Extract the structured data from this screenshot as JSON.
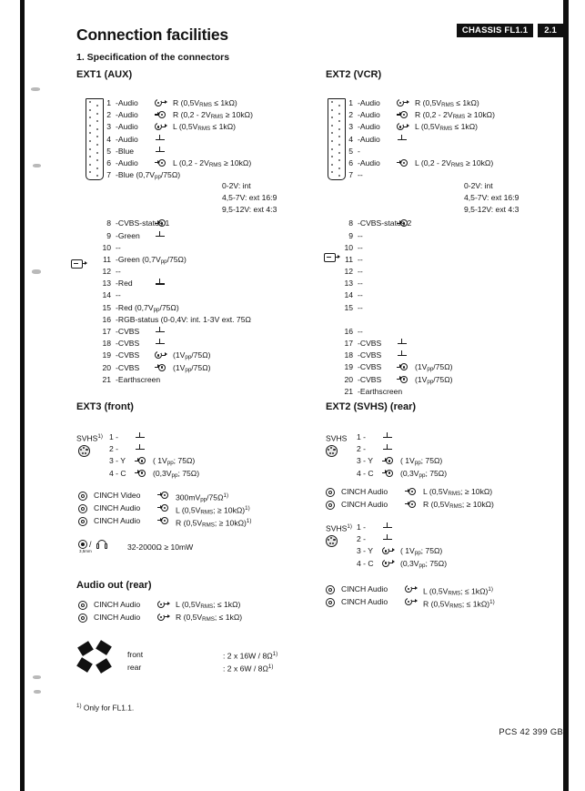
{
  "header": {
    "title": "Connection facilities",
    "subtitle": "1. Specification of the connectors",
    "chassis_badge": "CHASSIS FL1.1",
    "page_badge": "2.1"
  },
  "sections": {
    "ext1": {
      "heading": "EXT1 (AUX)",
      "pins": [
        {
          "no": "1",
          "name": "-Audio",
          "arrow": "out",
          "value": "R (0,5VRMS ≤ 1kΩ)"
        },
        {
          "no": "2",
          "name": "-Audio",
          "arrow": "in",
          "value": "R (0,2 - 2VRMS ≥ 10kΩ)"
        },
        {
          "no": "3",
          "name": "-Audio",
          "arrow": "out",
          "value": "L (0,5VRMS ≤ 1kΩ)"
        },
        {
          "no": "4",
          "name": "-Audio",
          "arrow": "gnd",
          "value": ""
        },
        {
          "no": "5",
          "name": "-Blue",
          "arrow": "gnd",
          "value": ""
        },
        {
          "no": "6",
          "name": "-Audio",
          "arrow": "in",
          "value": "L (0,2 - 2VRMS ≥ 10kΩ)"
        },
        {
          "no": "7",
          "name": "-Blue (0,7Vpp/75Ω)",
          "arrow": "none",
          "value": ""
        },
        {
          "no": "8",
          "name": "-CVBS-status 1",
          "arrow": "in",
          "value": ""
        },
        {
          "no": "9",
          "name": "-Green",
          "arrow": "gnd",
          "value": ""
        },
        {
          "no": "10",
          "name": "--",
          "arrow": "none",
          "value": ""
        },
        {
          "no": "11",
          "name": "-Green (0,7Vpp/75Ω)",
          "arrow": "none",
          "value": ""
        },
        {
          "no": "12",
          "name": "--",
          "arrow": "none",
          "value": ""
        },
        {
          "no": "13",
          "name": "-Red",
          "arrow": "gnd",
          "value": ""
        },
        {
          "no": "14",
          "name": "--",
          "arrow": "none",
          "value": ""
        },
        {
          "no": "15",
          "name": "-Red (0,7Vpp/75Ω)",
          "arrow": "none",
          "value": ""
        },
        {
          "no": "16",
          "name": "-RGB-status (0-0,4V: int. 1-3V ext. 75Ω",
          "arrow": "none",
          "value": ""
        },
        {
          "no": "17",
          "name": "-CVBS",
          "arrow": "gnd",
          "value": ""
        },
        {
          "no": "18",
          "name": "-CVBS",
          "arrow": "gnd",
          "value": ""
        },
        {
          "no": "19",
          "name": "-CVBS",
          "arrow": "out",
          "value": "(1Vpp/75Ω)"
        },
        {
          "no": "20",
          "name": "-CVBS",
          "arrow": "in",
          "value": "(1Vpp/75Ω)"
        },
        {
          "no": "21",
          "name": "-Earthscreen",
          "arrow": "none",
          "value": ""
        }
      ],
      "status": [
        "0-2V: int",
        "4,5-7V: ext 16:9",
        "9,5-12V: ext 4:3"
      ]
    },
    "ext2vcr": {
      "heading": "EXT2 (VCR)",
      "pins": [
        {
          "no": "1",
          "name": "-Audio",
          "arrow": "out",
          "value": "R (0,5VRMS ≤ 1kΩ)"
        },
        {
          "no": "2",
          "name": "-Audio",
          "arrow": "in",
          "value": "R (0,2 - 2VRMS ≥ 10kΩ)"
        },
        {
          "no": "3",
          "name": "-Audio",
          "arrow": "out",
          "value": "L (0,5VRMS ≤ 1kΩ)"
        },
        {
          "no": "4",
          "name": "-Audio",
          "arrow": "gnd",
          "value": ""
        },
        {
          "no": "5",
          "name": "-",
          "arrow": "none",
          "value": ""
        },
        {
          "no": "6",
          "name": "-Audio",
          "arrow": "in",
          "value": "L (0,2 - 2VRMS ≥ 10kΩ)"
        },
        {
          "no": "7",
          "name": "--",
          "arrow": "none",
          "value": ""
        },
        {
          "no": "8",
          "name": "-CVBS-status 2",
          "arrow": "in",
          "value": ""
        },
        {
          "no": "9",
          "name": "--",
          "arrow": "none",
          "value": ""
        },
        {
          "no": "10",
          "name": "--",
          "arrow": "none",
          "value": ""
        },
        {
          "no": "11",
          "name": "--",
          "arrow": "none",
          "value": ""
        },
        {
          "no": "12",
          "name": "--",
          "arrow": "none",
          "value": ""
        },
        {
          "no": "13",
          "name": "--",
          "arrow": "none",
          "value": ""
        },
        {
          "no": "14",
          "name": "--",
          "arrow": "none",
          "value": ""
        },
        {
          "no": "15",
          "name": "--",
          "arrow": "none",
          "value": ""
        },
        {
          "no": "16",
          "name": "--",
          "arrow": "none",
          "value": ""
        },
        {
          "no": "17",
          "name": "-CVBS",
          "arrow": "gnd",
          "value": ""
        },
        {
          "no": "18",
          "name": "-CVBS",
          "arrow": "gnd",
          "value": ""
        },
        {
          "no": "19",
          "name": "-CVBS",
          "arrow": "in",
          "value": "(1Vpp/75Ω)"
        },
        {
          "no": "20",
          "name": "-CVBS",
          "arrow": "in",
          "value": "(1Vpp/75Ω)"
        },
        {
          "no": "21",
          "name": "-Earthscreen",
          "arrow": "none",
          "value": ""
        }
      ],
      "status": [
        "0-2V: int",
        "4,5-7V: ext 16:9",
        "9,5-12V: ext 4:3"
      ]
    },
    "ext3": {
      "heading": "EXT3 (front)",
      "svhs_label": "SVHS",
      "svhs_sup": "1)",
      "svhs_pins": [
        {
          "no": "1 -",
          "arrow": "gnd",
          "value": ""
        },
        {
          "no": "2 -",
          "arrow": "gnd",
          "value": ""
        },
        {
          "no": "3 - Y",
          "arrow": "in",
          "value": "( 1Vpp; 75Ω)"
        },
        {
          "no": "4 - C",
          "arrow": "in",
          "value": "(0,3Vpp; 75Ω)"
        }
      ],
      "cinch": [
        {
          "label": "CINCH Video",
          "arrow": "in",
          "value": "300mVpp/75Ω",
          "sup": "1)"
        },
        {
          "label": "CINCH Audio",
          "arrow": "in",
          "value": "L (0,5VRMS; ≥ 10kΩ)",
          "sup": "1)"
        },
        {
          "label": "CINCH Audio",
          "arrow": "in",
          "value": "R (0,5VRMS; ≥ 10kΩ)",
          "sup": "1)"
        }
      ],
      "headphone": "32-2000Ω ≥ 10mW"
    },
    "audioout": {
      "heading": "Audio out (rear)",
      "cinch": [
        {
          "label": "CINCH Audio",
          "arrow": "out",
          "value": "L (0,5VRMS; ≤ 1kΩ)",
          "sup": ""
        },
        {
          "label": "CINCH Audio",
          "arrow": "out",
          "value": "R (0,5VRMS; ≤ 1kΩ)",
          "sup": ""
        }
      ],
      "speakers": [
        {
          "k": "front",
          "v": ": 2 x 16W / 8Ω",
          "sup": "1)"
        },
        {
          "k": "rear",
          "v": ": 2 x  6W / 8Ω",
          "sup": "1)"
        }
      ]
    },
    "ext2svhs": {
      "heading": "EXT2 (SVHS) (rear)",
      "block1": {
        "svhs_label": "SVHS",
        "svhs_sup": "",
        "svhs_pins": [
          {
            "no": "1 -",
            "arrow": "gnd",
            "value": ""
          },
          {
            "no": "2 -",
            "arrow": "gnd",
            "value": ""
          },
          {
            "no": "3 - Y",
            "arrow": "in",
            "value": "( 1Vpp; 75Ω)"
          },
          {
            "no": "4 - C",
            "arrow": "in",
            "value": "(0,3Vpp; 75Ω)"
          }
        ],
        "cinch": [
          {
            "label": "CINCH Audio",
            "arrow": "in",
            "value": "L (0,5VRMS; ≥ 10kΩ)",
            "sup": ""
          },
          {
            "label": "CINCH Audio",
            "arrow": "in",
            "value": "R (0,5VRMS; ≥ 10kΩ)",
            "sup": ""
          }
        ]
      },
      "block2": {
        "svhs_label": "SVHS",
        "svhs_sup": "1)",
        "svhs_pins": [
          {
            "no": "1 -",
            "arrow": "gnd",
            "value": ""
          },
          {
            "no": "2 -",
            "arrow": "gnd",
            "value": ""
          },
          {
            "no": "3 - Y",
            "arrow": "out",
            "value": "( 1Vpp; 75Ω)"
          },
          {
            "no": "4 - C",
            "arrow": "out",
            "value": "(0,3Vpp; 75Ω)"
          }
        ],
        "cinch": [
          {
            "label": "CINCH Audio",
            "arrow": "out",
            "value": "L (0,5VRMS; ≤ 1kΩ)",
            "sup": "1)"
          },
          {
            "label": "CINCH Audio",
            "arrow": "out",
            "value": "R (0,5VRMS; ≤ 1kΩ)",
            "sup": "1)"
          }
        ]
      }
    }
  },
  "footnote": "Only for FL1.1.",
  "footnote_sup": "1)",
  "footer": "PCS 42 399 GB"
}
